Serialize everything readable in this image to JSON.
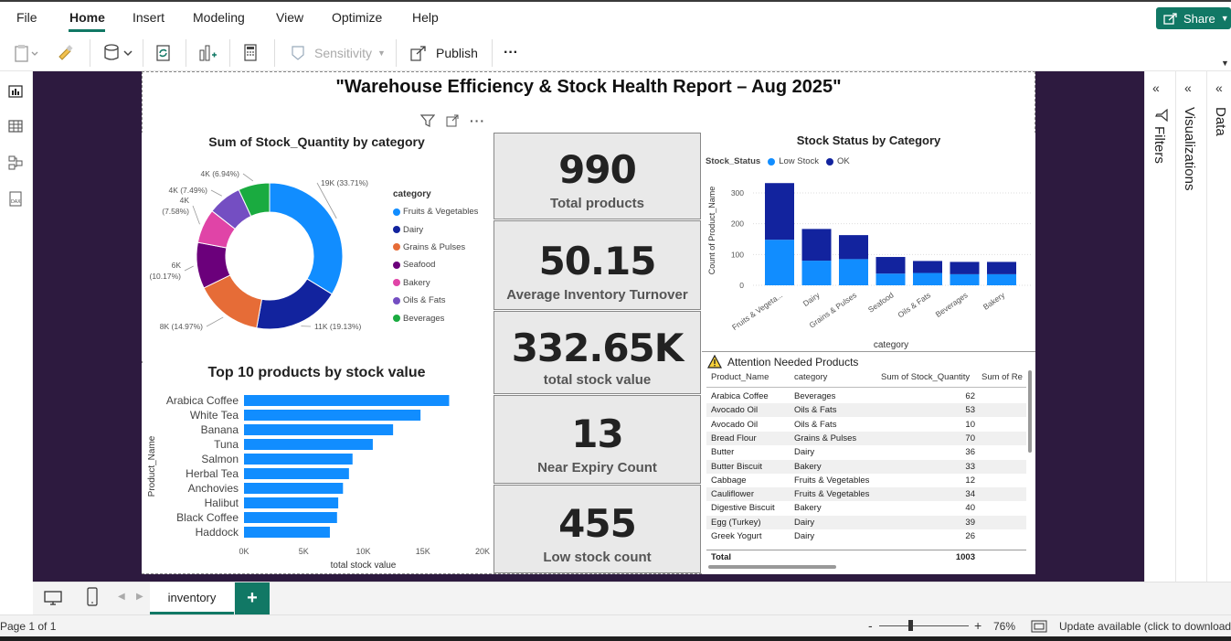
{
  "menu": {
    "items": [
      "File",
      "Home",
      "Insert",
      "Modeling",
      "View",
      "Optimize",
      "Help"
    ],
    "share_label": "Share"
  },
  "ribbon": {
    "sensitivity_label": "Sensitivity",
    "publish_label": "Publish",
    "more_label": "···"
  },
  "report": {
    "title": "\"Warehouse Efficiency & Stock Health Report – Aug 2025\""
  },
  "donut": {
    "title": "Sum of Stock_Quantity by category",
    "legend_title": "category",
    "chart_data": {
      "type": "pie",
      "categories": [
        "Fruits & Vegetables",
        "Dairy",
        "Grains & Pulses",
        "Seafood",
        "Bakery",
        "Oils & Fats",
        "Beverages"
      ],
      "values": [
        33.71,
        19.13,
        14.97,
        10.17,
        7.58,
        7.49,
        6.94
      ],
      "labels": [
        "19K (33.71%)",
        "11K (19.13%)",
        "8K (14.97%)",
        "6K\n(10.17%)",
        "4K\n(7.58%)",
        "4K (7.49%)",
        "4K (6.94%)"
      ],
      "colors": [
        "#118dff",
        "#12239e",
        "#e66c37",
        "#6b007b",
        "#e044a7",
        "#744ec2",
        "#1aab40"
      ]
    }
  },
  "status_chart": {
    "title": "Stock Status by Category",
    "legend_label": "Stock_Status",
    "chart_data": {
      "type": "bar",
      "stacked": true,
      "categories": [
        "Fruits & Vegeta...",
        "Dairy",
        "Grains & Pulses",
        "Seafood",
        "Oils & Fats",
        "Beverages",
        "Bakery"
      ],
      "series": [
        {
          "name": "Low Stock",
          "values": [
            148,
            80,
            85,
            38,
            40,
            36,
            36
          ],
          "color": "#118dff"
        },
        {
          "name": "OK",
          "values": [
            184,
            103,
            78,
            54,
            39,
            40,
            40
          ],
          "color": "#12239e"
        }
      ],
      "xlabel": "category",
      "ylabel": "Count of Product_Name",
      "ylim": [
        0,
        340
      ],
      "yticks": [
        "0",
        "100",
        "200",
        "300"
      ]
    }
  },
  "top10": {
    "title": "Top 10 products by stock value",
    "chart_data": {
      "type": "bar",
      "orientation": "horizontal",
      "categories": [
        "Arabica Coffee",
        "White Tea",
        "Banana",
        "Tuna",
        "Salmon",
        "Herbal Tea",
        "Anchovies",
        "Halibut",
        "Black Coffee",
        "Haddock"
      ],
      "values": [
        17200,
        14800,
        12500,
        10800,
        9100,
        8800,
        8300,
        7900,
        7800,
        7200
      ],
      "xlabel": "total stock value",
      "ylabel": "Product_Name",
      "xlim": [
        0,
        20000
      ],
      "xticks": [
        "0K",
        "5K",
        "10K",
        "15K",
        "20K"
      ],
      "color": "#118dff"
    }
  },
  "cards": [
    {
      "value": "990",
      "label": "Total products"
    },
    {
      "value": "50.15",
      "label": "Average Inventory Turnover"
    },
    {
      "value": "332.65K",
      "label": "total stock value"
    },
    {
      "value": "13",
      "label": "Near Expiry Count"
    },
    {
      "value": "455",
      "label": "Low stock count"
    }
  ],
  "table": {
    "title": "Attention Needed Products",
    "headers": [
      "Product_Name",
      "category",
      "Sum of Stock_Quantity",
      "Sum of Re"
    ],
    "rows": [
      [
        "Arabica Coffee",
        "Beverages",
        "62"
      ],
      [
        "Avocado Oil",
        "Oils & Fats",
        "53"
      ],
      [
        "Avocado Oil",
        "Oils & Fats",
        "10"
      ],
      [
        "Bread Flour",
        "Grains & Pulses",
        "70"
      ],
      [
        "Butter",
        "Dairy",
        "36"
      ],
      [
        "Butter Biscuit",
        "Bakery",
        "33"
      ],
      [
        "Cabbage",
        "Fruits & Vegetables",
        "12"
      ],
      [
        "Cauliflower",
        "Fruits & Vegetables",
        "34"
      ],
      [
        "Digestive Biscuit",
        "Bakery",
        "40"
      ],
      [
        "Egg (Turkey)",
        "Dairy",
        "39"
      ],
      [
        "Greek Yogurt",
        "Dairy",
        "26"
      ]
    ],
    "total_label": "Total",
    "total_value": "1003"
  },
  "panes": {
    "filters": "Filters",
    "visualizations": "Visualizations",
    "data": "Data"
  },
  "tabs": {
    "page_name": "inventory",
    "add_label": "+"
  },
  "status": {
    "page_info": "Page 1 of 1",
    "zoom": "76%",
    "update": "Update available (click to download"
  }
}
